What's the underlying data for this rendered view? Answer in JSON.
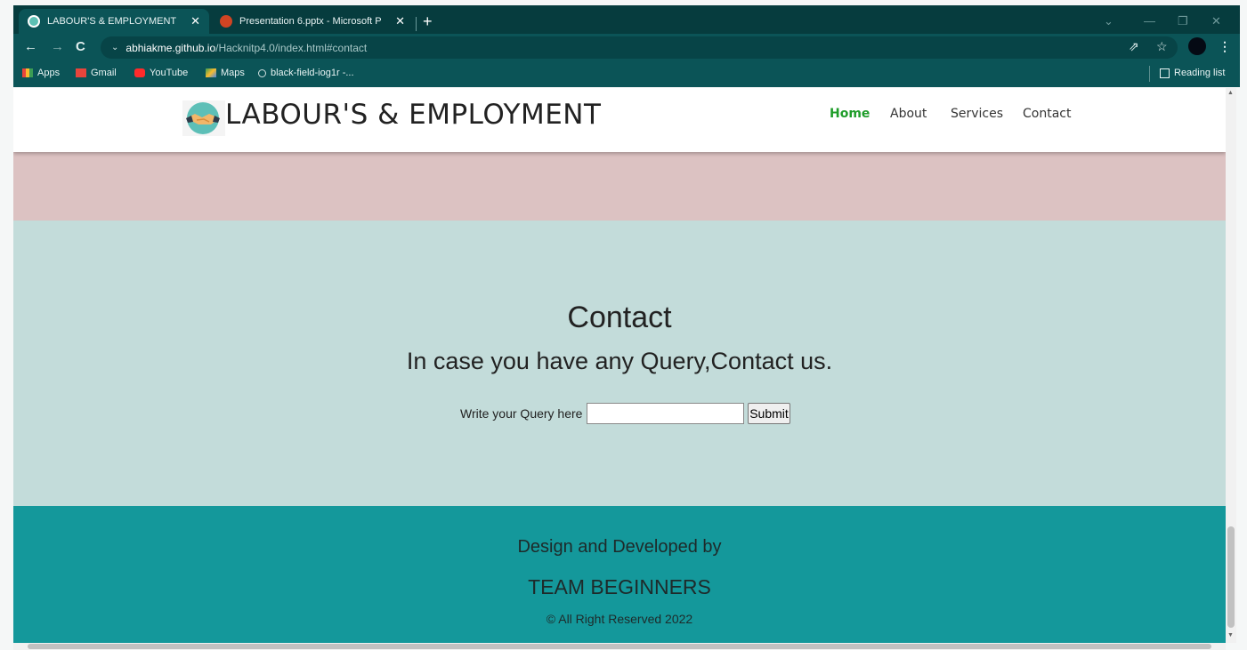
{
  "browser": {
    "tabs": [
      {
        "title": "LABOUR'S & EMPLOYMENT",
        "close": "✕"
      },
      {
        "title": "Presentation 6.pptx - Microsoft P",
        "close": "✕"
      }
    ],
    "new_tab": "+",
    "url_host": "abhiakme.github.io",
    "url_path": "/Hacknitp4.0/index.html#contact",
    "bookmarks": {
      "apps": "Apps",
      "gmail": "Gmail",
      "youtube": "YouTube",
      "maps": "Maps",
      "black_field": "black-field-iog1r -...",
      "reading_list": "Reading list"
    }
  },
  "site": {
    "brand": "LABOUR'S & EMPLOYMENT",
    "nav": {
      "home": "Home",
      "about": "About",
      "services": "Services",
      "contact": "Contact"
    },
    "nav_active_color": "#1f9d2a",
    "contact": {
      "title": "Contact",
      "subtitle": "In case you have any Query,Contact us.",
      "query_label": "Write your Query here",
      "query_value": "",
      "submit_label": "Submit"
    },
    "footer": {
      "line1": "Design and Developed by",
      "line2": "TEAM BEGINNERS",
      "line3": "© All Right Reserved 2022"
    },
    "colors": {
      "pink_band": "#dcc2c2",
      "contact_bg": "#c3dcda",
      "footer_bg": "#14989b",
      "chrome": "#0b5457"
    }
  }
}
